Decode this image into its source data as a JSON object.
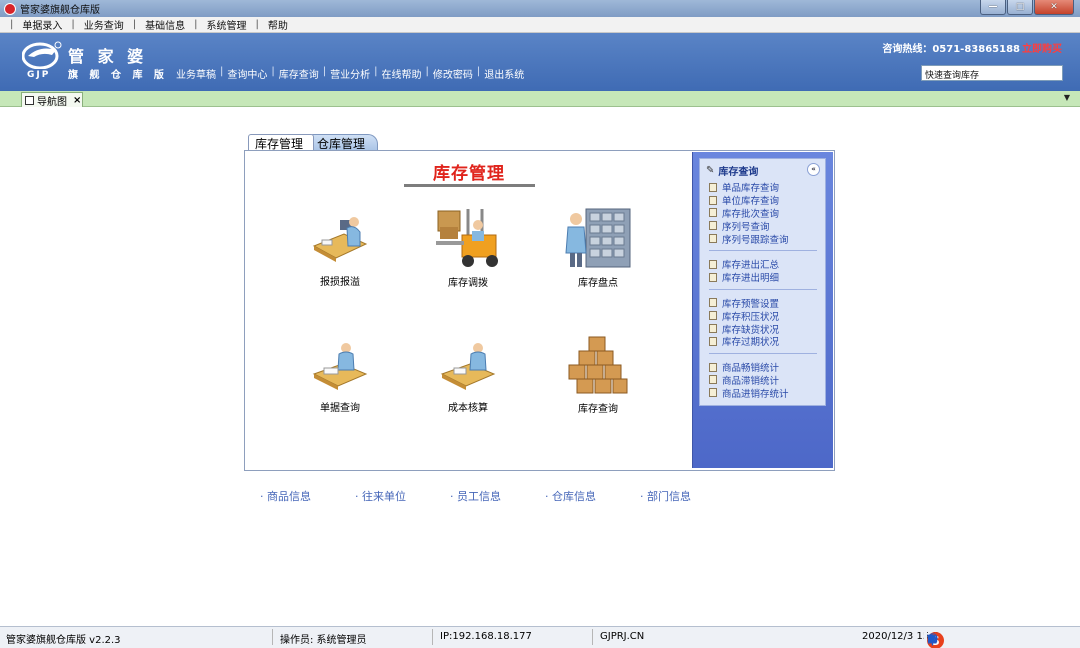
{
  "window": {
    "title": "管家婆旗舰仓库版",
    "buttons": [
      "minimize",
      "maximize",
      "close"
    ]
  },
  "menu": {
    "items": [
      "单据录入",
      "业务查询",
      "基础信息",
      "系统管理",
      "帮助"
    ]
  },
  "header": {
    "logo_name": "管 家 婆",
    "logo_sub": "旗 舰 仓 库 版",
    "logo_gjp": "GJP",
    "nav": [
      "业务草稿",
      "查询中心",
      "库存查询",
      "营业分析",
      "在线帮助",
      "修改密码",
      "退出系统"
    ],
    "hotline": "咨询热线：0571-83865188",
    "buy": "立即购买",
    "quick_search": "快速查询库存"
  },
  "tabstrip": {
    "tab_label": "导航图",
    "close": "×",
    "dropdown": "▼"
  },
  "panel": {
    "tabs": [
      "库存管理",
      "仓库管理"
    ],
    "title": "库存管理",
    "functions": [
      "报损报溢",
      "库存调拨",
      "库存盘点",
      "单据查询",
      "成本核算",
      "库存查询"
    ]
  },
  "side": {
    "title": "库存查询",
    "collapse": "«",
    "groups": [
      [
        "单品库存查询",
        "单位库存查询",
        "库存批次查询",
        "序列号查询",
        "序列号跟踪查询"
      ],
      [
        "库存进出汇总",
        "库存进出明细"
      ],
      [
        "库存预警设置",
        "库存积压状况",
        "库存缺货状况",
        "库存过期状况"
      ],
      [
        "商品畅销统计",
        "商品滞销统计",
        "商品进销存统计"
      ]
    ]
  },
  "basic_links": [
    "· 商品信息",
    "· 往来单位",
    "· 员工信息",
    "· 仓库信息",
    "· 部门信息"
  ],
  "status": {
    "version": "管家婆旗舰仓库版 v2.2.3",
    "operator": "操作员: 系统管理员",
    "ip": "IP:192.168.18.177",
    "site": "GJPRJ.CN",
    "datetime": "2020/12/3 15:5",
    "ime_label": "中"
  },
  "colors": {
    "header": "#4a75bd",
    "title_red": "#e0241c",
    "side_bg": "#5a76d4",
    "tab_strip": "#c6e7b8"
  }
}
